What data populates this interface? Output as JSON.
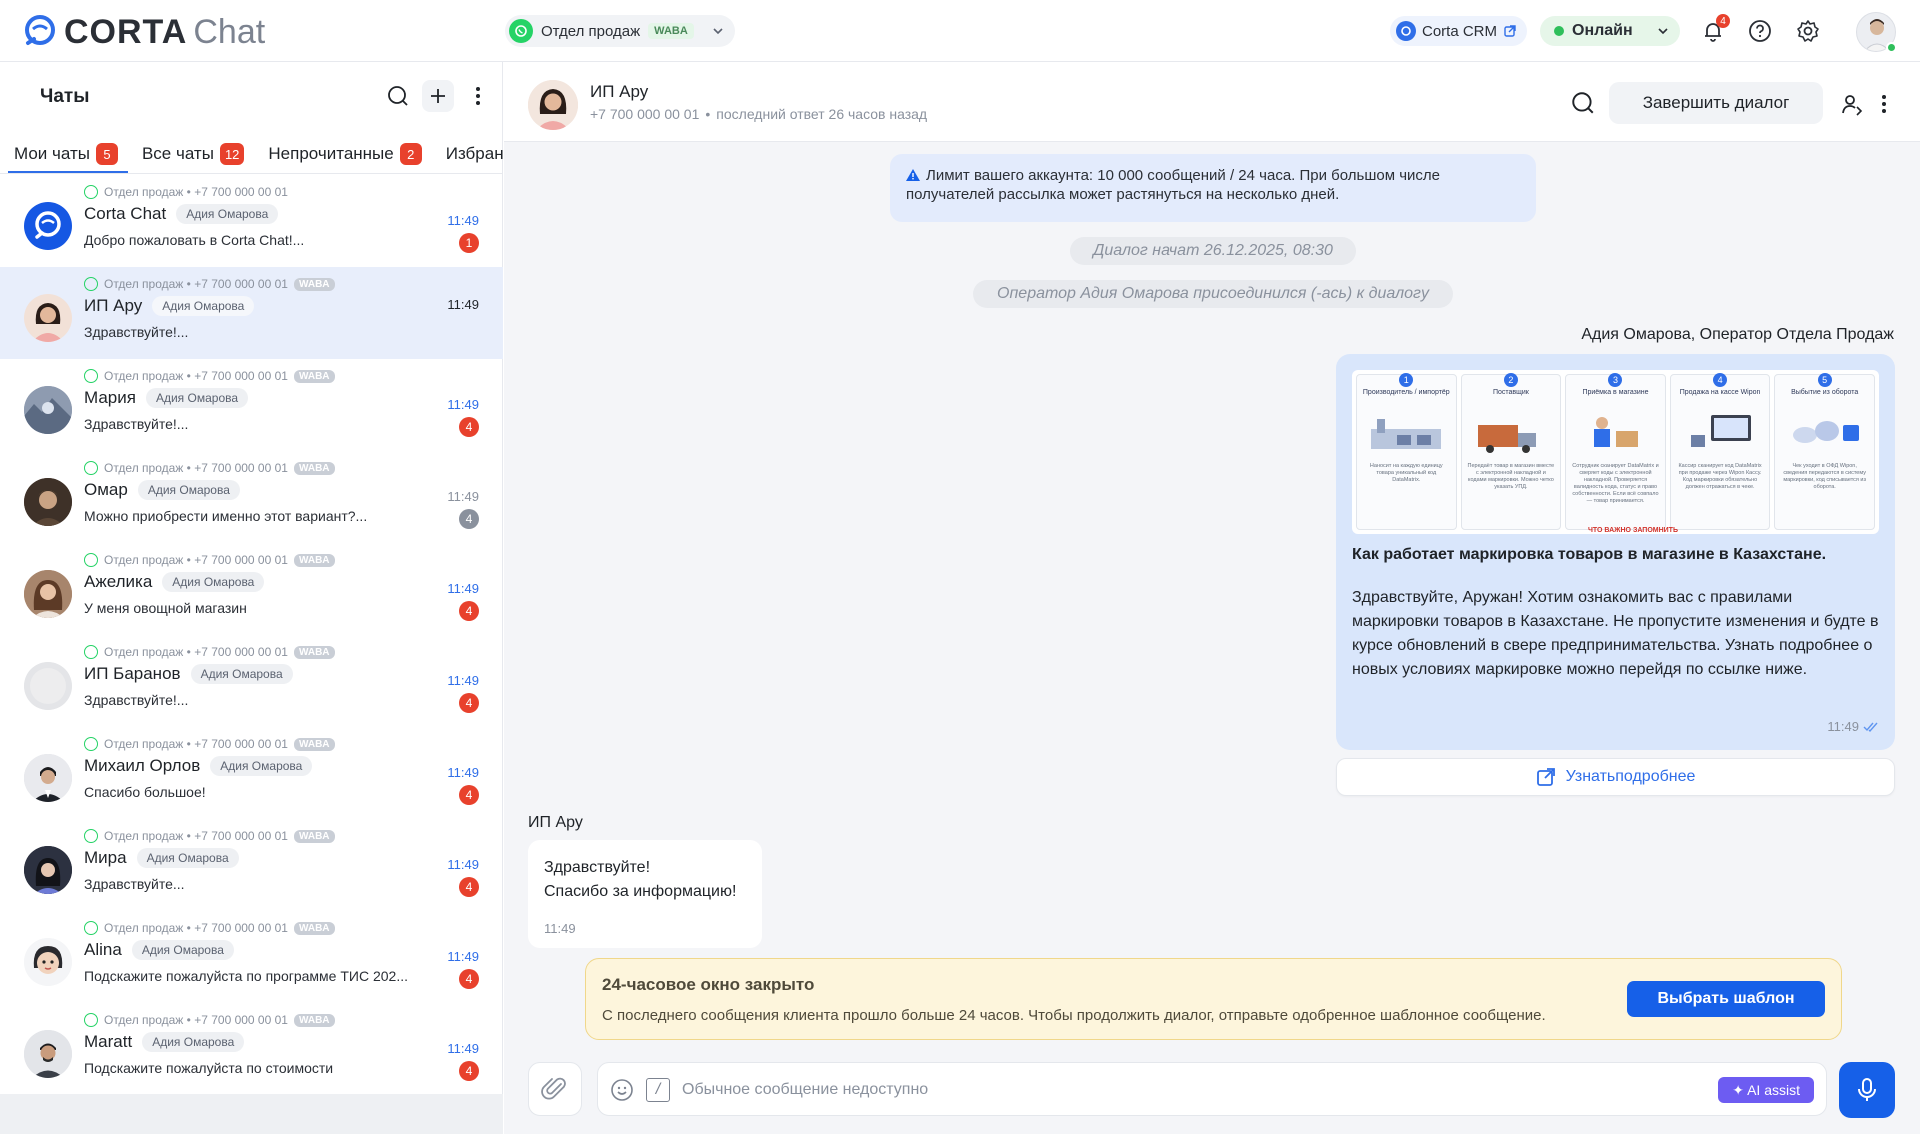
{
  "topbar": {
    "logo_a": "CORTA",
    "logo_b": "Chat",
    "channel": {
      "name": "Отдел продаж",
      "badge": "WABA"
    },
    "crm_link": "Corta CRM",
    "status": "Онлайн",
    "notifications_count": "4"
  },
  "sidebar": {
    "title": "Чаты",
    "tabs": [
      {
        "label": "Мои чаты",
        "count": "5"
      },
      {
        "label": "Все чаты",
        "count": "12"
      },
      {
        "label": "Непрочитанные",
        "count": "2"
      },
      {
        "label": "Избранные",
        "count": ""
      }
    ],
    "chats": [
      {
        "meta": "Отдел продаж • +7 700 000 00 01",
        "waba": "",
        "name": "Corta Chat",
        "agent": "Адия Омарова",
        "time": "11:49",
        "preview": "Добро пожаловать в Corta Chat!...",
        "unread": "1"
      },
      {
        "meta": "Отдел продаж • +7 700 000 00 01",
        "waba": "WABA",
        "name": "ИП Ару",
        "agent": "Адия Омарова",
        "time": "11:49",
        "preview": "Здравствуйте!...",
        "unread": ""
      },
      {
        "meta": "Отдел продаж • +7 700 000 00 01",
        "waba": "WABA",
        "name": "Мария",
        "agent": "Адия Омарова",
        "time": "11:49",
        "preview": "Здравствуйте!...",
        "unread": "4"
      },
      {
        "meta": "Отдел продаж • +7 700 000 00 01",
        "waba": "WABA",
        "name": "Омар",
        "agent": "Адия Омарова",
        "time": "11:49",
        "preview": "Можно приобрести именно этот вариант?...",
        "unread": "4"
      },
      {
        "meta": "Отдел продаж • +7 700 000 00 01",
        "waba": "WABA",
        "name": "Ажелика",
        "agent": "Адия Омарова",
        "time": "11:49",
        "preview": "У меня овощной магазин",
        "unread": "4"
      },
      {
        "meta": "Отдел продаж • +7 700 000 00 01",
        "waba": "WABA",
        "name": "ИП Баранов",
        "agent": "Адия Омарова",
        "time": "11:49",
        "preview": "Здравствуйте!...",
        "unread": "4"
      },
      {
        "meta": "Отдел продаж • +7 700 000 00 01",
        "waba": "WABA",
        "name": "Михаил Орлов",
        "agent": "Адия Омарова",
        "time": "11:49",
        "preview": "Спасибо большое!",
        "unread": "4"
      },
      {
        "meta": "Отдел продаж • +7 700 000 00 01",
        "waba": "WABA",
        "name": "Мира",
        "agent": "Адия Омарова",
        "time": "11:49",
        "preview": "Здравствуйте...",
        "unread": "4"
      },
      {
        "meta": "Отдел продаж • +7 700 000 00 01",
        "waba": "WABA",
        "name": "Alina",
        "agent": "Адия Омарова",
        "time": "11:49",
        "preview": "Подскажите пожалуйста по программе ТИС 202...",
        "unread": "4"
      },
      {
        "meta": "Отдел продаж • +7 700 000 00 01",
        "waba": "WABA",
        "name": "Maratt",
        "agent": "Адия Омарова",
        "time": "11:49",
        "preview": "Подскажите пожалуйста по стоимости",
        "unread": "4"
      }
    ]
  },
  "chat": {
    "header": {
      "name": "ИП Ару",
      "phone": "+7 700 000 00 01",
      "last_reply": "последний ответ 26 часов назад",
      "finish_label": "Завершить диалог"
    },
    "limit_notice": "Лимит вашего аккаунта: 10 000 сообщений / 24 часа. При большом числе получателей рассылка может растянуться на несколько дней.",
    "system": {
      "started": "Диалог начат 26.12.2025, 08:30",
      "joined": "Оператор Адия Омарова присоединился (-ась) к диалогу"
    },
    "outgoing": {
      "sender": "Адия Омарова, Оператор Отдела Продаж",
      "image": {
        "steps": [
          {
            "num": "1",
            "title": "Производитель / импортёр",
            "text": "Наносит на каждую единицу товара уникальный код DataMatrix."
          },
          {
            "num": "2",
            "title": "Поставщик",
            "text": "Передаёт товар в магазин вместе с электронной накладной и кодами маркировки. Можно четко указать УПД."
          },
          {
            "num": "3",
            "title": "Приёмка в магазине",
            "text": "Сотрудник сканирует DataMatrix и сверяет коды с электронной накладной. Проверяется валидность кода, статус и право собственности. Если всё совпало — товар принимается."
          },
          {
            "num": "4",
            "title": "Продажа на кассе Wipon",
            "text": "Кассир сканирует код DataMatrix при продаже через Wipon Кассу. Код маркировки обязательно должен отражаться в чеке."
          },
          {
            "num": "5",
            "title": "Выбытие из оборота",
            "text": "Чек уходит в ОФД Wipon, сведения передаются в систему маркировки, код списывается из оборота."
          }
        ],
        "warning": "ЧТО ВАЖНО ЗАПОМНИТЬ"
      },
      "title": "Как работает маркировка товаров в магазине в Казахстане.",
      "text": "Здравствуйте, Аружан! Хотим ознакомить вас с правилами маркировки товаров в Казахстане. Не пропустите изменения и будте в курсе обновлений в свере предпринимательства. Узнать подробнее о новых условиях маркировке можно перейдя по ссылке ниже.",
      "time": "11:49",
      "link_label": "Узнатьподробнее"
    },
    "incoming": {
      "sender": "ИП Ару",
      "line1": "Здравствуйте!",
      "line2": "Спасибо за информацию!",
      "time": "11:49"
    },
    "window_closed": {
      "title": "24-часовое окно закрыто",
      "text": "С последнего сообщения клиента прошло больше 24 часов. Чтобы продолжить диалог, отправьте одобренное шаблонное сообщение.",
      "button": "Выбрать шаблон"
    },
    "composer": {
      "placeholder": "Обычное сообщение недоступно",
      "ai_label": "✦ AI assist",
      "slash": "/"
    }
  },
  "colors": {
    "accent": "#2f6ee8",
    "primary_button": "#1660e8",
    "unread": "#e8412c",
    "online": "#2fbf5b",
    "warning_bg": "#fdf5dc"
  },
  "icons": [
    "search-icon",
    "plus-icon",
    "kebab-icon",
    "bell-icon",
    "help-icon",
    "gear-icon",
    "external-link-icon",
    "chevron-down-icon",
    "whatsapp-icon",
    "paperclip-icon",
    "emoji-icon",
    "mic-icon",
    "person-icon",
    "double-check-icon",
    "warning-triangle-icon"
  ]
}
